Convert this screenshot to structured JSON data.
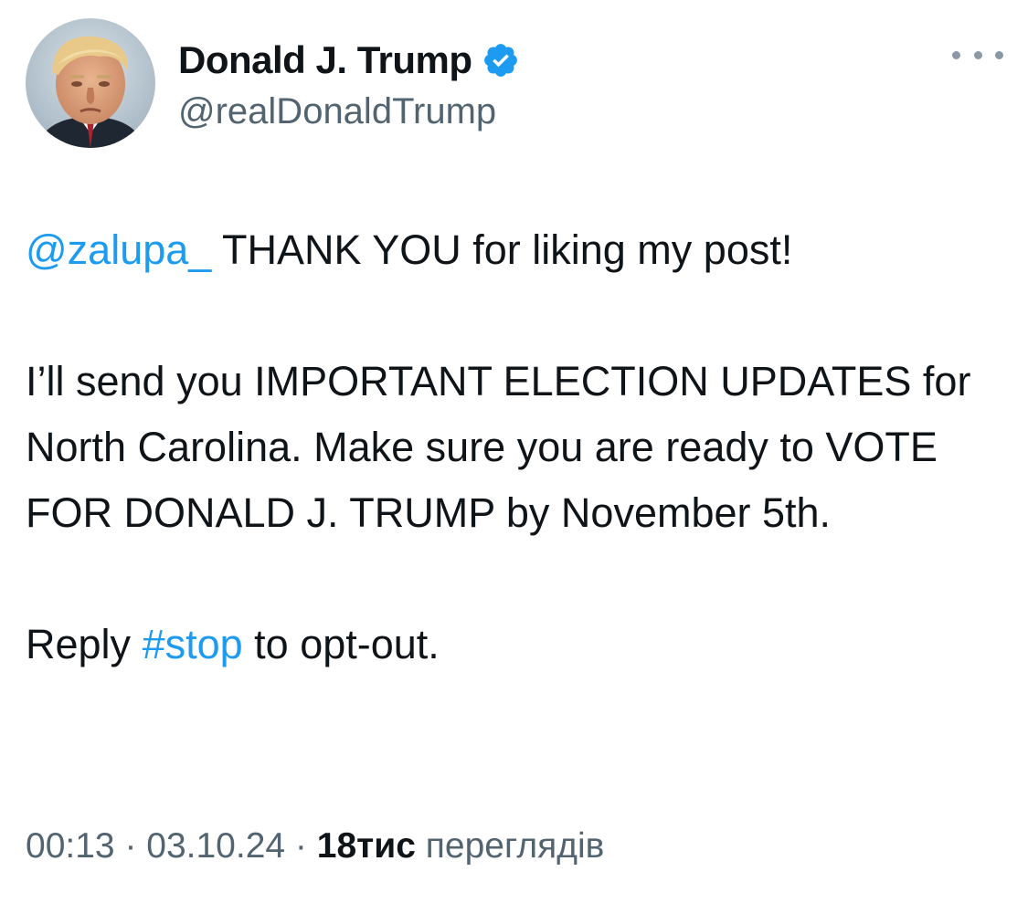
{
  "author": {
    "display_name": "Donald J. Trump",
    "handle": "@realDonaldTrump",
    "verified": true,
    "verified_color": "#1d9bf0"
  },
  "header": {
    "more_icon": "more-horizontal-icon"
  },
  "tweet": {
    "mention": "@zalupa_",
    "line1_rest": " THANK YOU for liking my post!",
    "para2": "I’ll send you IMPORTANT ELECTION UPDATES for North Carolina. Make sure you are ready to VOTE FOR DONALD J. TRUMP by November 5th.",
    "para3_prefix": "Reply ",
    "hashtag": "#stop",
    "para3_suffix": " to opt-out."
  },
  "meta": {
    "time": "00:13",
    "separator": " · ",
    "date": "03.10.24",
    "views_count": "18тис",
    "views_label": " переглядів"
  },
  "colors": {
    "link": "#1d9bf0",
    "text": "#0f1419",
    "secondary": "#536471"
  }
}
